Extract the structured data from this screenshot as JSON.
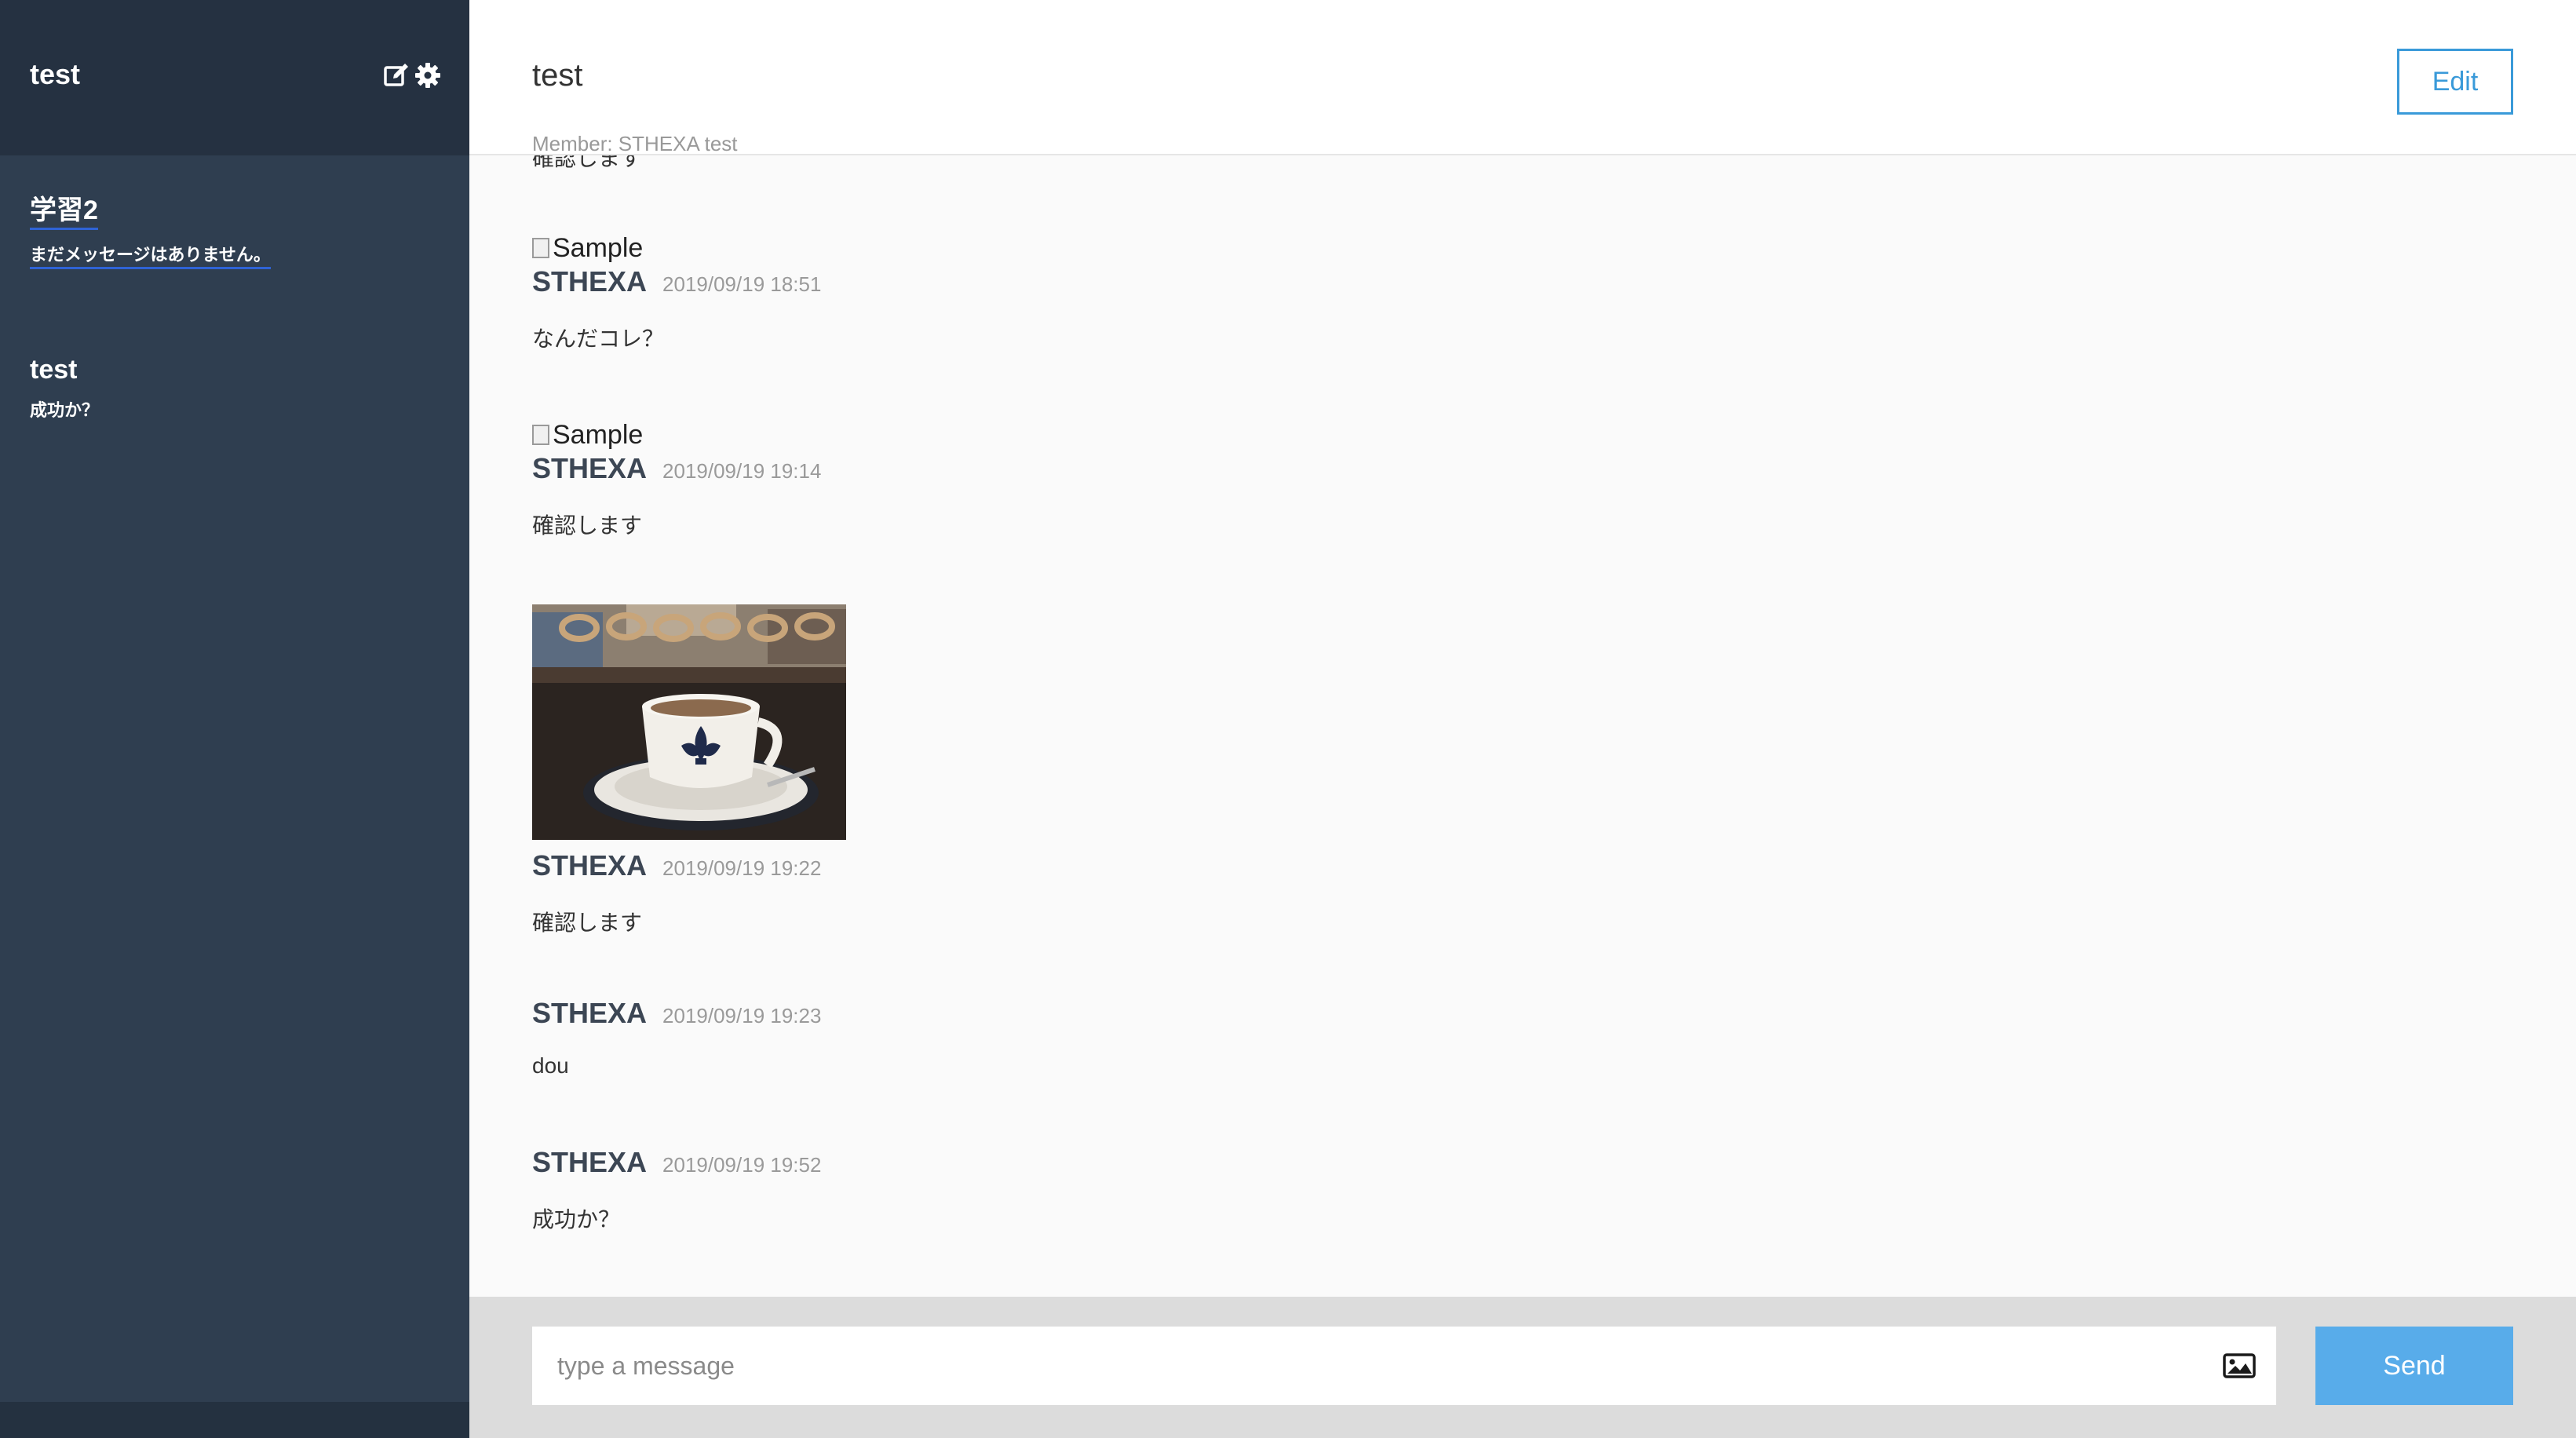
{
  "sidebar": {
    "title": "test",
    "icons": [
      "edit-icon",
      "gear-icon"
    ],
    "groups": [
      {
        "name": "学習2",
        "last_message": "まだメッセージはありません。"
      },
      {
        "name": "test",
        "last_message": "成功か？"
      }
    ]
  },
  "chat": {
    "title": "test",
    "members": "Member: STHEXA test",
    "edit_label": "Edit"
  },
  "messages": [
    {
      "image_alt": "Sample",
      "user": "STHEXA",
      "time": "2019/09/19 18:51",
      "text": "なんだコレ？"
    },
    {
      "image_alt": "Sample",
      "user": "STHEXA",
      "time": "2019/09/19 19:14",
      "text": "確認します"
    },
    {
      "image": "photo-coffee-cup",
      "user": "STHEXA",
      "time": "2019/09/19 19:22",
      "text": "確認します"
    },
    {
      "user": "STHEXA",
      "time": "2019/09/19 19:23",
      "text": "dou"
    },
    {
      "user": "STHEXA",
      "time": "2019/09/19 19:52",
      "text": "成功か？"
    }
  ],
  "composer": {
    "placeholder": "type a message",
    "image_icon": "image-icon",
    "send_label": "Send"
  },
  "colors": {
    "sidebar_bg": "#2f3e50",
    "sidebar_header_bg": "#253141",
    "accent": "#3a9ad9",
    "send_bg": "#58acea"
  }
}
